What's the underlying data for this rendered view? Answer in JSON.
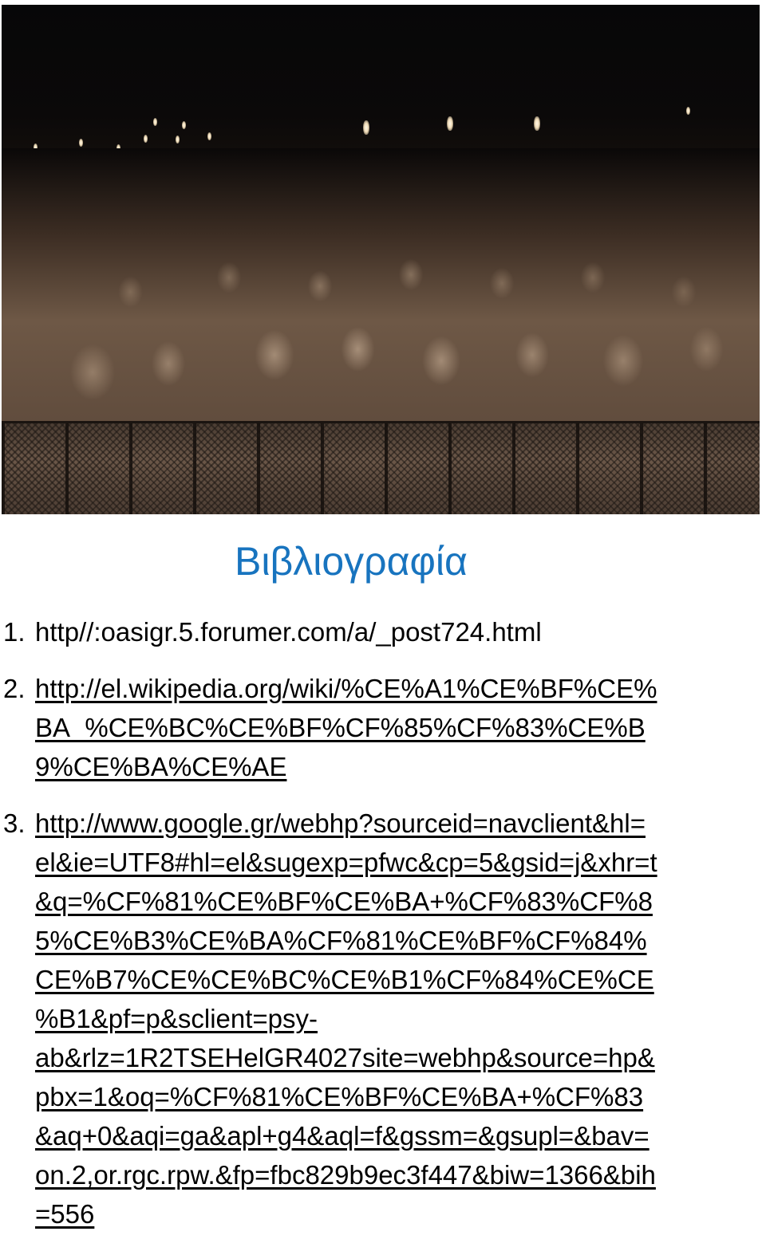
{
  "photo": {
    "description": "Sepia-toned photograph of a concert crowd at night behind a metal barrier, many fans making horns gestures",
    "tone_colors": {
      "sky": "#0a0808",
      "highlight": "#f0dcb8",
      "midtone": "#6b5748"
    }
  },
  "heading": {
    "title": "Βιβλιογραφία",
    "color": "#1874bf"
  },
  "references": [
    {
      "number": "1.",
      "underlined": false,
      "lines": [
        "http//:oasigr.5.forumer.com/a/_post724.html"
      ]
    },
    {
      "number": "2.",
      "underlined": true,
      "lines": [
        "http://el.wikipedia.org/wiki/%CE%A1%CE%BF%CE%",
        "BA_%CE%BC%CE%BF%CF%85%CF%83%CE%B",
        "9%CE%BA%CE%AE"
      ]
    },
    {
      "number": "3.",
      "underlined": true,
      "lines": [
        "http://www.google.gr/webhp?sourceid=navclient&hl=",
        "el&ie=UTF8#hl=el&sugexp=pfwc&cp=5&gsid=j&xhr=t",
        "&q=%CF%81%CE%BF%CE%BA+%CF%83%CF%8",
        "5%CE%B3%CE%BA%CF%81%CE%BF%CF%84%",
        "CE%B7%CE%CE%BC%CE%B1%CF%84%CE%CE",
        "%B1&pf=p&sclient=psy-",
        "ab&rlz=1R2TSEHelGR4027site=webhp&source=hp&",
        "pbx=1&oq=%CF%81%CE%BF%CE%BA+%CF%83",
        "&aq+0&aqi=ga&apl+g4&aql=f&gssm=&gsupl=&bav=",
        "on.2,or.rgc.rpw.&fp=fbc829b9ec3f447&biw=1366&bih",
        "=556"
      ]
    }
  ]
}
